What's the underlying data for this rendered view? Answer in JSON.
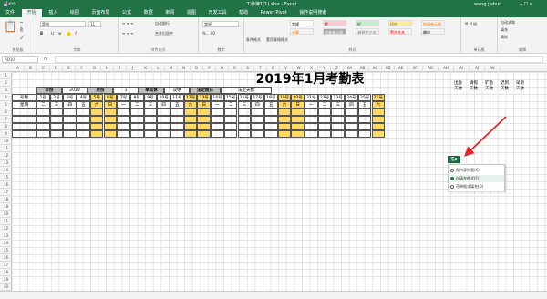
{
  "window": {
    "title": "工作簿1(1).xlsx - Excel",
    "user": "wang jiahui"
  },
  "ribbon_tabs": [
    "文件",
    "开始",
    "插入",
    "绘图",
    "页面布局",
    "公式",
    "数据",
    "审阅",
    "视图",
    "开发工具",
    "帮助",
    "Power Pivot",
    "操作说明搜索"
  ],
  "active_tab": "开始",
  "ribbon": {
    "clipboard": "剪贴板",
    "font": "字体",
    "font_name": "等线",
    "font_size": "11",
    "alignment": "对齐方式",
    "wrap": "自动换行",
    "merge": "合并后居中",
    "number": "数字",
    "number_format": "常规",
    "cond_format": "条件格式",
    "table_format": "套用表格格式",
    "styles": "样式",
    "style_normal": "常规",
    "style_bad": "差",
    "style_good": "好",
    "style_neutral": "适中",
    "style_calc": "计算",
    "style_check": "检查单元格",
    "style_explain": "解释性文本",
    "style_warn": "警告文本",
    "style_link": "链接单元格",
    "style_output": "输出",
    "cells": "单元格",
    "autosum": "自动求和",
    "fill": "填充",
    "clear": "清除",
    "edit": "编辑"
  },
  "formula_bar": {
    "name_box": "AD10",
    "fx": "fx"
  },
  "columns": [
    "A",
    "B",
    "C",
    "D",
    "E",
    "F",
    "G",
    "H",
    "I",
    "J",
    "K",
    "L",
    "M",
    "N",
    "O",
    "P",
    "Q",
    "R",
    "S",
    "T",
    "U",
    "V",
    "W",
    "X",
    "Y",
    "Z",
    "AA",
    "AB",
    "AC",
    "AD",
    "AE",
    "AF",
    "AG",
    "AH",
    "AI",
    "AJ",
    "AK"
  ],
  "rows": [
    "1",
    "2",
    "3",
    "4",
    "5",
    "6",
    "7",
    "8",
    "9",
    "10",
    "11",
    "12",
    "13",
    "14",
    "15",
    "16",
    "17",
    "18",
    "19",
    "20",
    "21",
    "22",
    "23",
    "24",
    "25",
    "26",
    "27",
    "28",
    "29",
    "30"
  ],
  "sheet": {
    "title": "2019年1月考勤表",
    "year_label": "年份",
    "year_value": "2019",
    "month_label": "月份",
    "month_value": "1",
    "weekend_label": "单双休",
    "weekend_value": "双休",
    "holiday_label": "法定假日",
    "holiday_days": "法定天数",
    "row_num_label": "号数",
    "row_week_label": "星期",
    "days": [
      "1号",
      "2号",
      "3号",
      "4号",
      "5号",
      "6号",
      "7号",
      "8号",
      "9号",
      "10号",
      "11号",
      "12号",
      "13号",
      "14号",
      "15号",
      "16号",
      "17号",
      "18号",
      "19号",
      "20号",
      "21号",
      "22号",
      "23号",
      "24号",
      "25号",
      "26号"
    ],
    "weekdays": [
      "二",
      "三",
      "四",
      "五",
      "六",
      "日",
      "一",
      "二",
      "三",
      "四",
      "五",
      "六",
      "日",
      "一",
      "二",
      "三",
      "四",
      "五",
      "六",
      "日",
      "一",
      "二",
      "三",
      "四",
      "五",
      "六"
    ],
    "summary_headers": [
      "出勤\n天数",
      "请假\n天数",
      "旷勤\n天数",
      "迟到\n天数",
      "早退\n天数"
    ]
  },
  "paste_options": {
    "icon": "paste-options-icon",
    "items": [
      "保持源列宽(K)",
      "仅填充格式(F)",
      "不带格式填充(O)"
    ],
    "selected": 1
  },
  "colors": {
    "accent": "#217346",
    "weekend": "#ffd966",
    "header_gray": "#bfbfbf",
    "arrow": "#e0262a"
  }
}
